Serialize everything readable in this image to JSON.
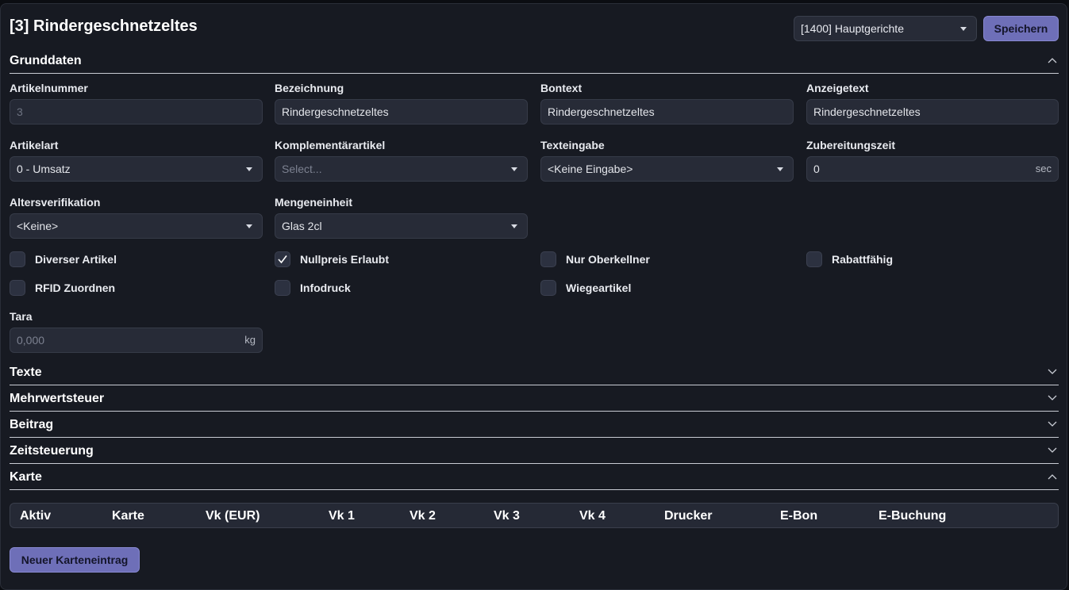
{
  "header": {
    "title": "[3] Rindergeschnetzeltes",
    "group_select_value": "[1400] Hauptgerichte",
    "save_label": "Speichern"
  },
  "sections": {
    "grunddaten": "Grunddaten",
    "texte": "Texte",
    "mehrwertsteuer": "Mehrwertsteuer",
    "beitrag": "Beitrag",
    "zeitsteuerung": "Zeitsteuerung",
    "karte": "Karte"
  },
  "fields": {
    "artikelnummer": {
      "label": "Artikelnummer",
      "value": "3"
    },
    "bezeichnung": {
      "label": "Bezeichnung",
      "value": "Rindergeschnetzeltes"
    },
    "bontext": {
      "label": "Bontext",
      "value": "Rindergeschnetzeltes"
    },
    "anzeigetext": {
      "label": "Anzeigetext",
      "value": "Rindergeschnetzeltes"
    },
    "artikelart": {
      "label": "Artikelart",
      "value": "0 - Umsatz"
    },
    "komplementaer": {
      "label": "Komplementärartikel",
      "placeholder": "Select..."
    },
    "texteingabe": {
      "label": "Texteingabe",
      "value": "<Keine Eingabe>"
    },
    "zubereitungszeit": {
      "label": "Zubereitungszeit",
      "value": "0",
      "unit": "sec"
    },
    "altersverifikation": {
      "label": "Altersverifikation",
      "value": "<Keine>"
    },
    "mengeneinheit": {
      "label": "Mengeneinheit",
      "value": "Glas 2cl"
    },
    "tara": {
      "label": "Tara",
      "placeholder": "0,000",
      "unit": "kg"
    }
  },
  "checkboxes": [
    {
      "label": "Diverser Artikel",
      "checked": false
    },
    {
      "label": "Nullpreis Erlaubt",
      "checked": true
    },
    {
      "label": "Nur Oberkellner",
      "checked": false
    },
    {
      "label": "Rabattfähig",
      "checked": false
    },
    {
      "label": "RFID Zuordnen",
      "checked": false
    },
    {
      "label": "Infodruck",
      "checked": false
    },
    {
      "label": "Wiegeartikel",
      "checked": false
    }
  ],
  "karte_table": {
    "columns": [
      "Aktiv",
      "Karte",
      "Vk (EUR)",
      "Vk 1",
      "Vk 2",
      "Vk 3",
      "Vk 4",
      "Drucker",
      "E-Bon",
      "E-Buchung"
    ]
  },
  "new_entry_label": "Neuer Karteneintrag"
}
